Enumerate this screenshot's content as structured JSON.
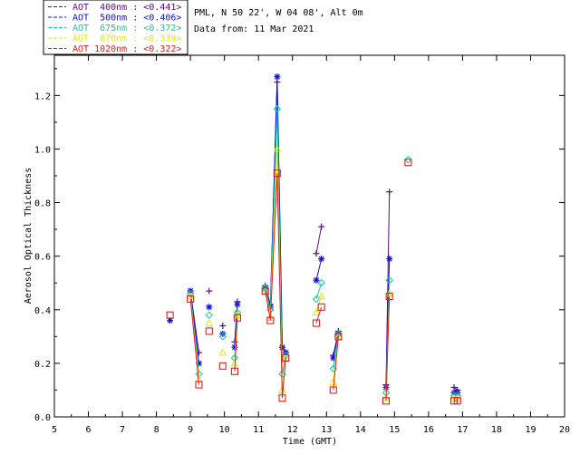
{
  "header": {
    "site": "PML, N 50 22', W 04 08', Alt 0m",
    "date": "Data from: 11 Mar 2021"
  },
  "chart_data": {
    "type": "line",
    "title": "",
    "xlabel": "Time (GMT)",
    "ylabel": "Aerosol Optical Thickness",
    "xlim": [
      5,
      20
    ],
    "ylim": [
      0,
      1.35
    ],
    "xticks": [
      "5",
      "6",
      "7",
      "8",
      "9",
      "10",
      "11",
      "12",
      "13",
      "14",
      "15",
      "16",
      "17",
      "18",
      "19",
      "20"
    ],
    "yticks": [
      "0.0",
      "0.2",
      "0.4",
      "0.6",
      "0.8",
      "1.0",
      "1.2"
    ],
    "grid": false,
    "legend_position": "top-left, outside plot",
    "series": [
      {
        "name": "AOT  400nm : <0.441>",
        "color": "#5a0a8c",
        "marker": "plus",
        "segments": [
          [
            [
              9.0,
              0.47
            ],
            [
              9.25,
              0.24
            ]
          ],
          [
            [
              9.55,
              0.47
            ]
          ],
          [
            [
              9.95,
              0.34
            ]
          ],
          [
            [
              10.3,
              0.28
            ],
            [
              10.38,
              0.43
            ]
          ],
          [
            [
              11.2,
              0.49
            ],
            [
              11.35,
              0.42
            ],
            [
              11.55,
              1.25
            ],
            [
              11.7,
              0.26
            ],
            [
              11.8,
              0.24
            ]
          ],
          [
            [
              12.7,
              0.61
            ],
            [
              12.85,
              0.71
            ]
          ],
          [
            [
              13.2,
              0.23
            ],
            [
              13.35,
              0.32
            ]
          ],
          [
            [
              14.75,
              0.12
            ],
            [
              14.85,
              0.84
            ]
          ],
          [
            [
              16.75,
              0.11
            ],
            [
              16.85,
              0.1
            ]
          ]
        ]
      },
      {
        "name": "AOT  500nm : <0.406>",
        "color": "#1010e0",
        "marker": "asterisk",
        "segments": [
          [
            [
              8.4,
              0.36
            ]
          ],
          [
            [
              9.0,
              0.47
            ],
            [
              9.25,
              0.2
            ]
          ],
          [
            [
              9.55,
              0.41
            ]
          ],
          [
            [
              9.95,
              0.31
            ]
          ],
          [
            [
              10.3,
              0.26
            ],
            [
              10.38,
              0.42
            ]
          ],
          [
            [
              11.2,
              0.48
            ],
            [
              11.35,
              0.41
            ],
            [
              11.55,
              1.27
            ],
            [
              11.7,
              0.26
            ],
            [
              11.8,
              0.24
            ]
          ],
          [
            [
              12.7,
              0.51
            ],
            [
              12.85,
              0.59
            ]
          ],
          [
            [
              13.2,
              0.22
            ],
            [
              13.35,
              0.31
            ]
          ],
          [
            [
              14.75,
              0.11
            ],
            [
              14.85,
              0.59
            ]
          ],
          [
            [
              16.75,
              0.09
            ],
            [
              16.85,
              0.09
            ]
          ]
        ]
      },
      {
        "name": "AOT  675nm : <0.372>",
        "color": "#10c8a0",
        "marker": "diamond",
        "segments": [
          [
            [
              9.0,
              0.46
            ],
            [
              9.25,
              0.16
            ]
          ],
          [
            [
              9.55,
              0.38
            ]
          ],
          [
            [
              9.95,
              0.3
            ]
          ],
          [
            [
              10.3,
              0.22
            ],
            [
              10.38,
              0.39
            ]
          ],
          [
            [
              11.2,
              0.48
            ],
            [
              11.35,
              0.4
            ],
            [
              11.55,
              1.15
            ],
            [
              11.7,
              0.16
            ],
            [
              11.8,
              0.23
            ]
          ],
          [
            [
              12.7,
              0.44
            ],
            [
              12.85,
              0.5
            ]
          ],
          [
            [
              13.2,
              0.18
            ],
            [
              13.35,
              0.31
            ]
          ],
          [
            [
              14.75,
              0.09
            ],
            [
              14.85,
              0.51
            ]
          ],
          [
            [
              15.4,
              0.96
            ]
          ],
          [
            [
              16.75,
              0.08
            ],
            [
              16.85,
              0.08
            ]
          ]
        ]
      },
      {
        "name": "AOT  870nm : <0.339>",
        "color": "#e6e600",
        "marker": "triangle",
        "segments": [
          [
            [
              9.0,
              0.45
            ],
            [
              9.25,
              0.14
            ]
          ],
          [
            [
              9.55,
              0.35
            ]
          ],
          [
            [
              9.95,
              0.24
            ]
          ],
          [
            [
              10.3,
              0.2
            ],
            [
              10.38,
              0.38
            ]
          ],
          [
            [
              11.2,
              0.47
            ],
            [
              11.35,
              0.37
            ],
            [
              11.55,
              1.0
            ],
            [
              11.7,
              0.1
            ],
            [
              11.8,
              0.22
            ]
          ],
          [
            [
              12.7,
              0.39
            ],
            [
              12.85,
              0.45
            ]
          ],
          [
            [
              13.2,
              0.13
            ],
            [
              13.35,
              0.3
            ]
          ],
          [
            [
              14.75,
              0.07
            ],
            [
              14.85,
              0.46
            ]
          ],
          [
            [
              16.75,
              0.07
            ],
            [
              16.85,
              0.07
            ]
          ]
        ]
      },
      {
        "name": "AOT 1020nm : <0.322>",
        "color": "#e02020",
        "marker": "square",
        "segments": [
          [
            [
              8.4,
              0.38
            ]
          ],
          [
            [
              9.0,
              0.44
            ],
            [
              9.25,
              0.12
            ]
          ],
          [
            [
              9.55,
              0.32
            ]
          ],
          [
            [
              9.95,
              0.19
            ]
          ],
          [
            [
              10.3,
              0.17
            ],
            [
              10.38,
              0.37
            ]
          ],
          [
            [
              11.2,
              0.47
            ],
            [
              11.35,
              0.36
            ],
            [
              11.55,
              0.91
            ],
            [
              11.7,
              0.07
            ],
            [
              11.8,
              0.22
            ]
          ],
          [
            [
              12.7,
              0.35
            ],
            [
              12.85,
              0.41
            ]
          ],
          [
            [
              13.2,
              0.1
            ],
            [
              13.35,
              0.3
            ]
          ],
          [
            [
              14.75,
              0.06
            ],
            [
              14.85,
              0.45
            ]
          ],
          [
            [
              15.4,
              0.95
            ]
          ],
          [
            [
              16.75,
              0.06
            ],
            [
              16.85,
              0.06
            ]
          ]
        ]
      }
    ]
  }
}
